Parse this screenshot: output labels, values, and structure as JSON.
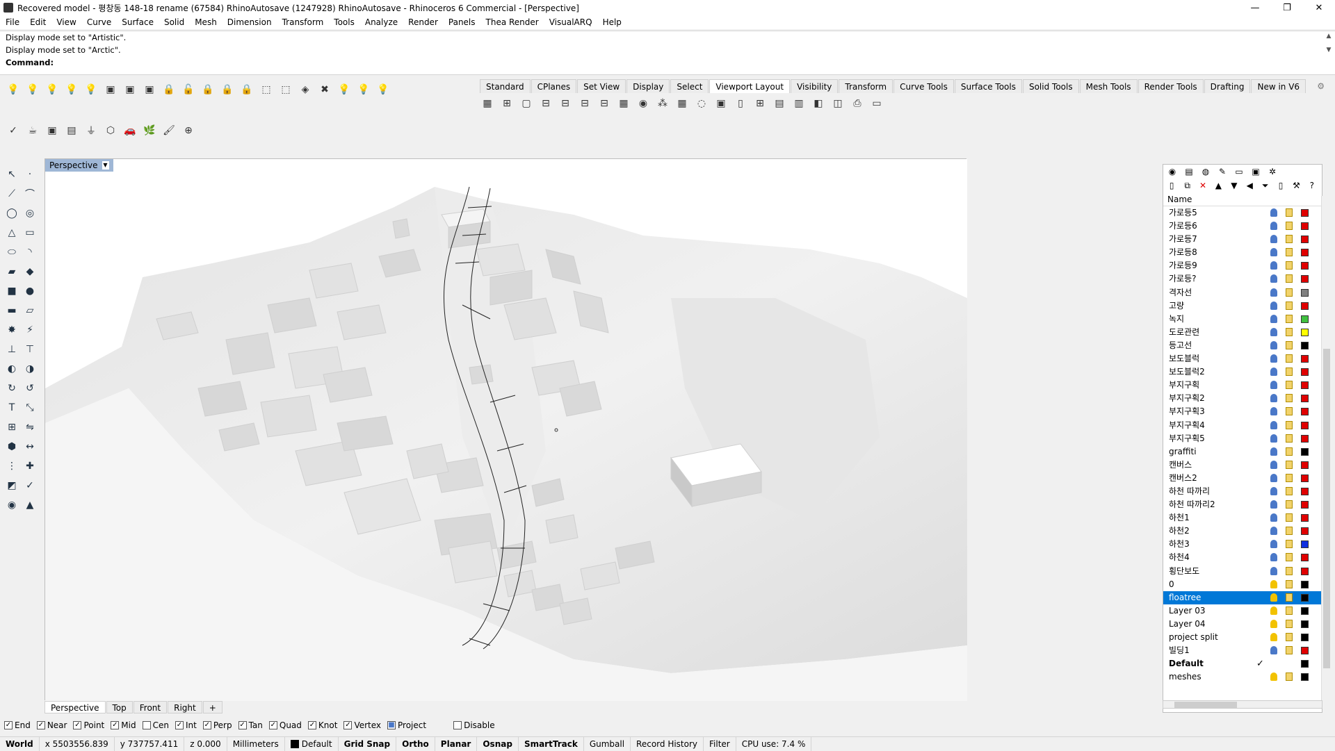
{
  "window": {
    "title": "Recovered model - 평창동 148-18 rename (67584) RhinoAutosave (1247928) RhinoAutosave - Rhinoceros 6 Commercial - [Perspective]",
    "controls": {
      "minimize": "—",
      "restore": "❐",
      "close": "✕"
    }
  },
  "menu": [
    "File",
    "Edit",
    "View",
    "Curve",
    "Surface",
    "Solid",
    "Mesh",
    "Dimension",
    "Transform",
    "Tools",
    "Analyze",
    "Render",
    "Panels",
    "Thea Render",
    "VisualARQ",
    "Help"
  ],
  "command": {
    "history": [
      "Display mode set to \"Artistic\".",
      "Display mode set to \"Arctic\"."
    ],
    "prompt": "Command:"
  },
  "toolbar_tabs": [
    "Standard",
    "CPlanes",
    "Set View",
    "Display",
    "Select",
    "Viewport Layout",
    "Visibility",
    "Transform",
    "Curve Tools",
    "Surface Tools",
    "Solid Tools",
    "Mesh Tools",
    "Render Tools",
    "Drafting",
    "New in V6"
  ],
  "active_toolbar_tab": "Viewport Layout",
  "viewport": {
    "name": "Perspective"
  },
  "viewport_tabs": [
    "Perspective",
    "Top",
    "Front",
    "Right",
    "+"
  ],
  "osnaps": [
    {
      "label": "End",
      "checked": true
    },
    {
      "label": "Near",
      "checked": true
    },
    {
      "label": "Point",
      "checked": true
    },
    {
      "label": "Mid",
      "checked": true
    },
    {
      "label": "Cen",
      "checked": false
    },
    {
      "label": "Int",
      "checked": true
    },
    {
      "label": "Perp",
      "checked": true
    },
    {
      "label": "Tan",
      "checked": true
    },
    {
      "label": "Quad",
      "checked": true
    },
    {
      "label": "Knot",
      "checked": true
    },
    {
      "label": "Vertex",
      "checked": true
    },
    {
      "label": "Project",
      "checked": true
    },
    {
      "label": "Disable",
      "checked": false
    }
  ],
  "status": {
    "cplane": "World",
    "x": "x 5503556.839",
    "y": "y 737757.411",
    "z": "z 0.000",
    "units": "Millimeters",
    "layer": "Default",
    "toggles": [
      "Grid Snap",
      "Ortho",
      "Planar",
      "Osnap",
      "SmartTrack",
      "Gumball",
      "Record History",
      "Filter"
    ],
    "toggles_on": [
      "Grid Snap",
      "Ortho",
      "Planar",
      "Osnap",
      "SmartTrack"
    ],
    "cpu": "CPU use: 7.4 %"
  },
  "layers": {
    "header": "Name",
    "rows": [
      {
        "name": "가로등5",
        "color": "#e00000",
        "bulb": "#4a78c8"
      },
      {
        "name": "가로등6",
        "color": "#e00000",
        "bulb": "#4a78c8"
      },
      {
        "name": "가로등7",
        "color": "#e00000",
        "bulb": "#4a78c8"
      },
      {
        "name": "가로등8",
        "color": "#e00000",
        "bulb": "#4a78c8"
      },
      {
        "name": "가로등9",
        "color": "#e00000",
        "bulb": "#4a78c8"
      },
      {
        "name": "가로등?",
        "color": "#e00000",
        "bulb": "#4a78c8"
      },
      {
        "name": "격자선",
        "color": "#808080",
        "bulb": "#4a78c8"
      },
      {
        "name": "고량",
        "color": "#e00000",
        "bulb": "#4a78c8"
      },
      {
        "name": "녹지",
        "color": "#40c040",
        "bulb": "#4a78c8"
      },
      {
        "name": "도로관련",
        "color": "#ffff00",
        "bulb": "#4a78c8"
      },
      {
        "name": "등고선",
        "color": "#000000",
        "bulb": "#4a78c8"
      },
      {
        "name": "보도블럭",
        "color": "#e00000",
        "bulb": "#4a78c8"
      },
      {
        "name": "보도블럭2",
        "color": "#e00000",
        "bulb": "#4a78c8"
      },
      {
        "name": "부지구획",
        "color": "#e00000",
        "bulb": "#4a78c8"
      },
      {
        "name": "부지구획2",
        "color": "#e00000",
        "bulb": "#4a78c8"
      },
      {
        "name": "부지구획3",
        "color": "#e00000",
        "bulb": "#4a78c8"
      },
      {
        "name": "부지구획4",
        "color": "#e00000",
        "bulb": "#4a78c8"
      },
      {
        "name": "부지구획5",
        "color": "#e00000",
        "bulb": "#4a78c8"
      },
      {
        "name": "graffiti",
        "color": "#000000",
        "bulb": "#4a78c8"
      },
      {
        "name": "캔버스",
        "color": "#e00000",
        "bulb": "#4a78c8"
      },
      {
        "name": "캔버스2",
        "color": "#e00000",
        "bulb": "#4a78c8"
      },
      {
        "name": "하천 따까리",
        "color": "#e00000",
        "bulb": "#4a78c8"
      },
      {
        "name": "하천 따까리2",
        "color": "#e00000",
        "bulb": "#4a78c8"
      },
      {
        "name": "하천1",
        "color": "#e00000",
        "bulb": "#4a78c8"
      },
      {
        "name": "하천2",
        "color": "#e00000",
        "bulb": "#4a78c8"
      },
      {
        "name": "하천3",
        "color": "#1030e0",
        "bulb": "#4a78c8"
      },
      {
        "name": "하천4",
        "color": "#e00000",
        "bulb": "#4a78c8"
      },
      {
        "name": "횡단보도",
        "color": "#e00000",
        "bulb": "#4a78c8"
      },
      {
        "name": "0",
        "color": "#000000",
        "bulb": "#f2c200"
      },
      {
        "name": "floatree",
        "color": "#000000",
        "bulb": "#f2c200",
        "selected": true
      },
      {
        "name": "Layer 03",
        "color": "#000000",
        "bulb": "#f2c200"
      },
      {
        "name": "Layer 04",
        "color": "#000000",
        "bulb": "#f2c200"
      },
      {
        "name": "project split",
        "color": "#000000",
        "bulb": "#f2c200"
      },
      {
        "name": "빌딩1",
        "color": "#e00000",
        "bulb": "#4a78c8"
      },
      {
        "name": "Default",
        "color": "#000000",
        "bulb": "",
        "current": true,
        "check": "✓"
      },
      {
        "name": "meshes",
        "color": "#000000",
        "bulb": "#f2c200"
      }
    ]
  }
}
